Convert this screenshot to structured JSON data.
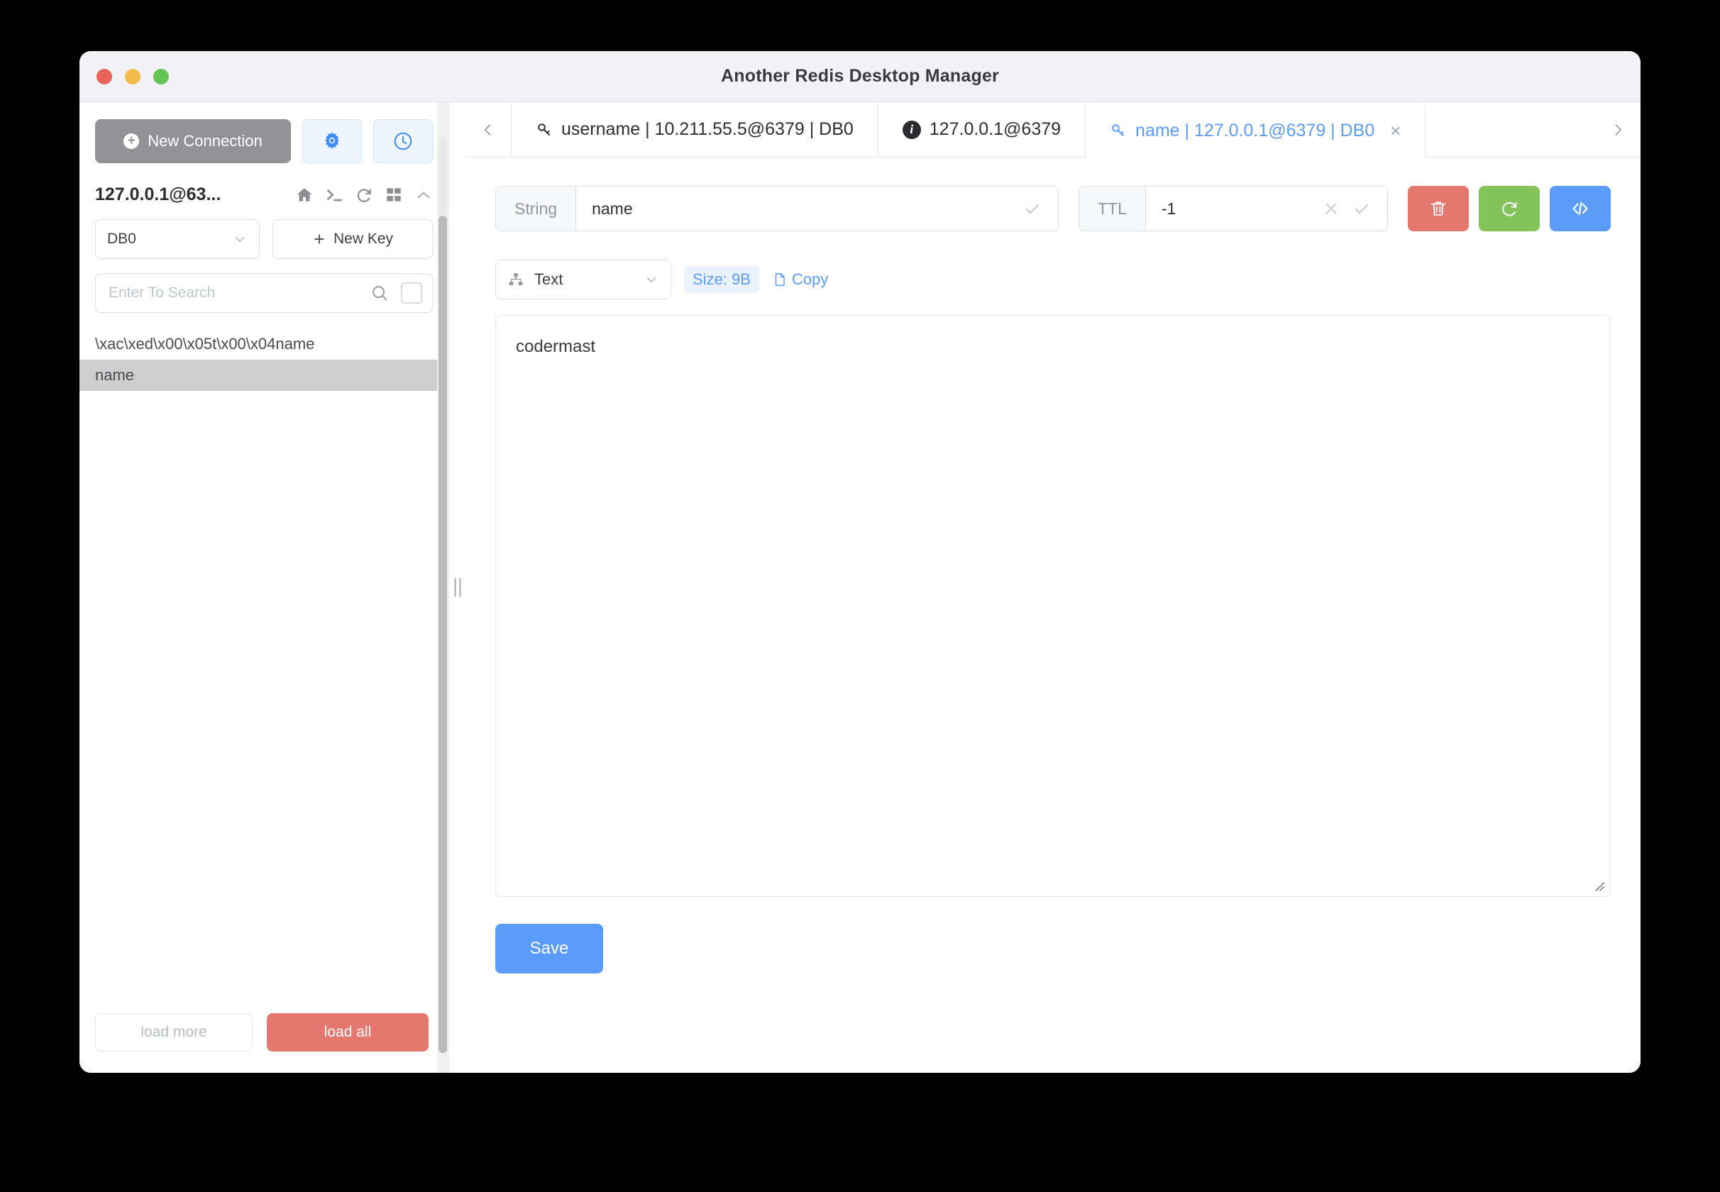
{
  "window": {
    "title": "Another Redis Desktop Manager",
    "traffic_lights": [
      "close-red",
      "minimize-yellow",
      "maximize-green"
    ]
  },
  "sidebar": {
    "new_connection_label": "New Connection",
    "toolbar_icons": [
      "settings-gear-icon",
      "history-clock-icon"
    ],
    "connection": {
      "name": "127.0.0.1@63...",
      "icons": [
        "home-icon",
        "console-icon",
        "refresh-icon",
        "grid-icon",
        "collapse-chevron-icon"
      ]
    },
    "db_select": {
      "value": "DB0",
      "options": [
        "DB0"
      ]
    },
    "new_key_label": "New Key",
    "search": {
      "value": "",
      "placeholder": "Enter To Search"
    },
    "keys": [
      {
        "label": "\\xac\\xed\\x00\\x05t\\x00\\x04name",
        "selected": false
      },
      {
        "label": "name",
        "selected": true
      }
    ],
    "footer": {
      "load_more_label": "load more",
      "load_all_label": "load all"
    }
  },
  "tabbar": {
    "prev_label": "‹",
    "next_label": "›",
    "tabs": [
      {
        "label": "username | 10.211.55.5@6379 | DB0",
        "icon": "key-icon",
        "active": false,
        "closable": false
      },
      {
        "label": "127.0.0.1@6379",
        "icon": "info-icon",
        "active": false,
        "closable": false
      },
      {
        "label": "name | 127.0.0.1@6379 | DB0",
        "icon": "key-icon",
        "active": true,
        "closable": true,
        "close_label": "×"
      }
    ]
  },
  "editor": {
    "key_type_label": "String",
    "key_name": "name",
    "ttl_label": "TTL",
    "ttl_value": "-1",
    "action_buttons": [
      {
        "name": "delete-key-button",
        "icon": "trash-icon",
        "color": "#e4786f"
      },
      {
        "name": "refresh-key-button",
        "icon": "refresh-icon",
        "color": "#83c35a"
      },
      {
        "name": "open-console-button",
        "icon": "code-icon",
        "color": "#5b9cf8"
      }
    ],
    "format_select": {
      "value": "Text",
      "options": [
        "Text"
      ],
      "icon": "hierarchy-icon"
    },
    "size_badge": "Size: 9B",
    "copy_label": "Copy",
    "value": "codermast",
    "save_label": "Save"
  },
  "colors": {
    "accent_blue": "#5b9cf8",
    "danger_red": "#e4786f",
    "success_green": "#83c35a",
    "muted_gray": "#929297",
    "selected_row": "#cecece"
  }
}
